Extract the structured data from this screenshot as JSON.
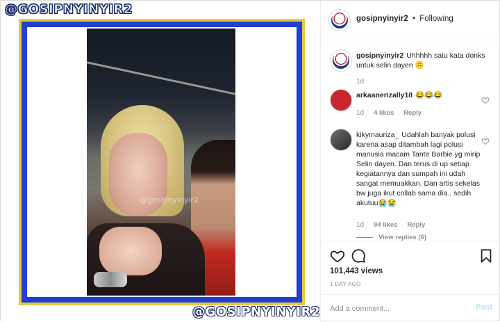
{
  "media": {
    "watermark_top": "@GOSIPNYINYIR2",
    "watermark_bottom": "@GOSIPNYINYIR2",
    "video_watermark": "@gosipnyinyir2"
  },
  "header": {
    "username": "gosipnyinyir2",
    "separator": "•",
    "follow_status": "Following"
  },
  "comments": [
    {
      "username": "gosipnyinyir2",
      "text": "Uhhhhh satu kata donks untuk selin dayen",
      "emoji": "🙃",
      "time": "1d",
      "likes": "",
      "reply": ""
    },
    {
      "username": "arkaanerizally18",
      "text": "",
      "emoji": "😂😂😂",
      "time": "1d",
      "likes": "4 likes",
      "reply": "Reply"
    },
    {
      "username": "kikymauriza_",
      "text": "Udahlah banyak polusi karena asap ditambah lagi polusi manusia macam Tante Barbie yg mirip Selin dayen. Dan terus di up setiap kegiatannya dan sumpah ini udah sangat memuakkan. Dan artis sekelas bw juga ikut collab sama dia.. sedih akutuu",
      "emoji": "😭😭",
      "time": "1d",
      "likes": "94 likes",
      "reply": "Reply",
      "view_replies": "View replies (6)"
    }
  ],
  "actions": {
    "views": "101,443 views",
    "ago": "1 DAY AGO"
  },
  "add_comment": {
    "placeholder": "Add a comment...",
    "post_label": "Post"
  },
  "colors": {
    "border_gold": "#e8c93a",
    "border_blue": "#1f3fd6",
    "post_disabled": "#b2dffc"
  }
}
